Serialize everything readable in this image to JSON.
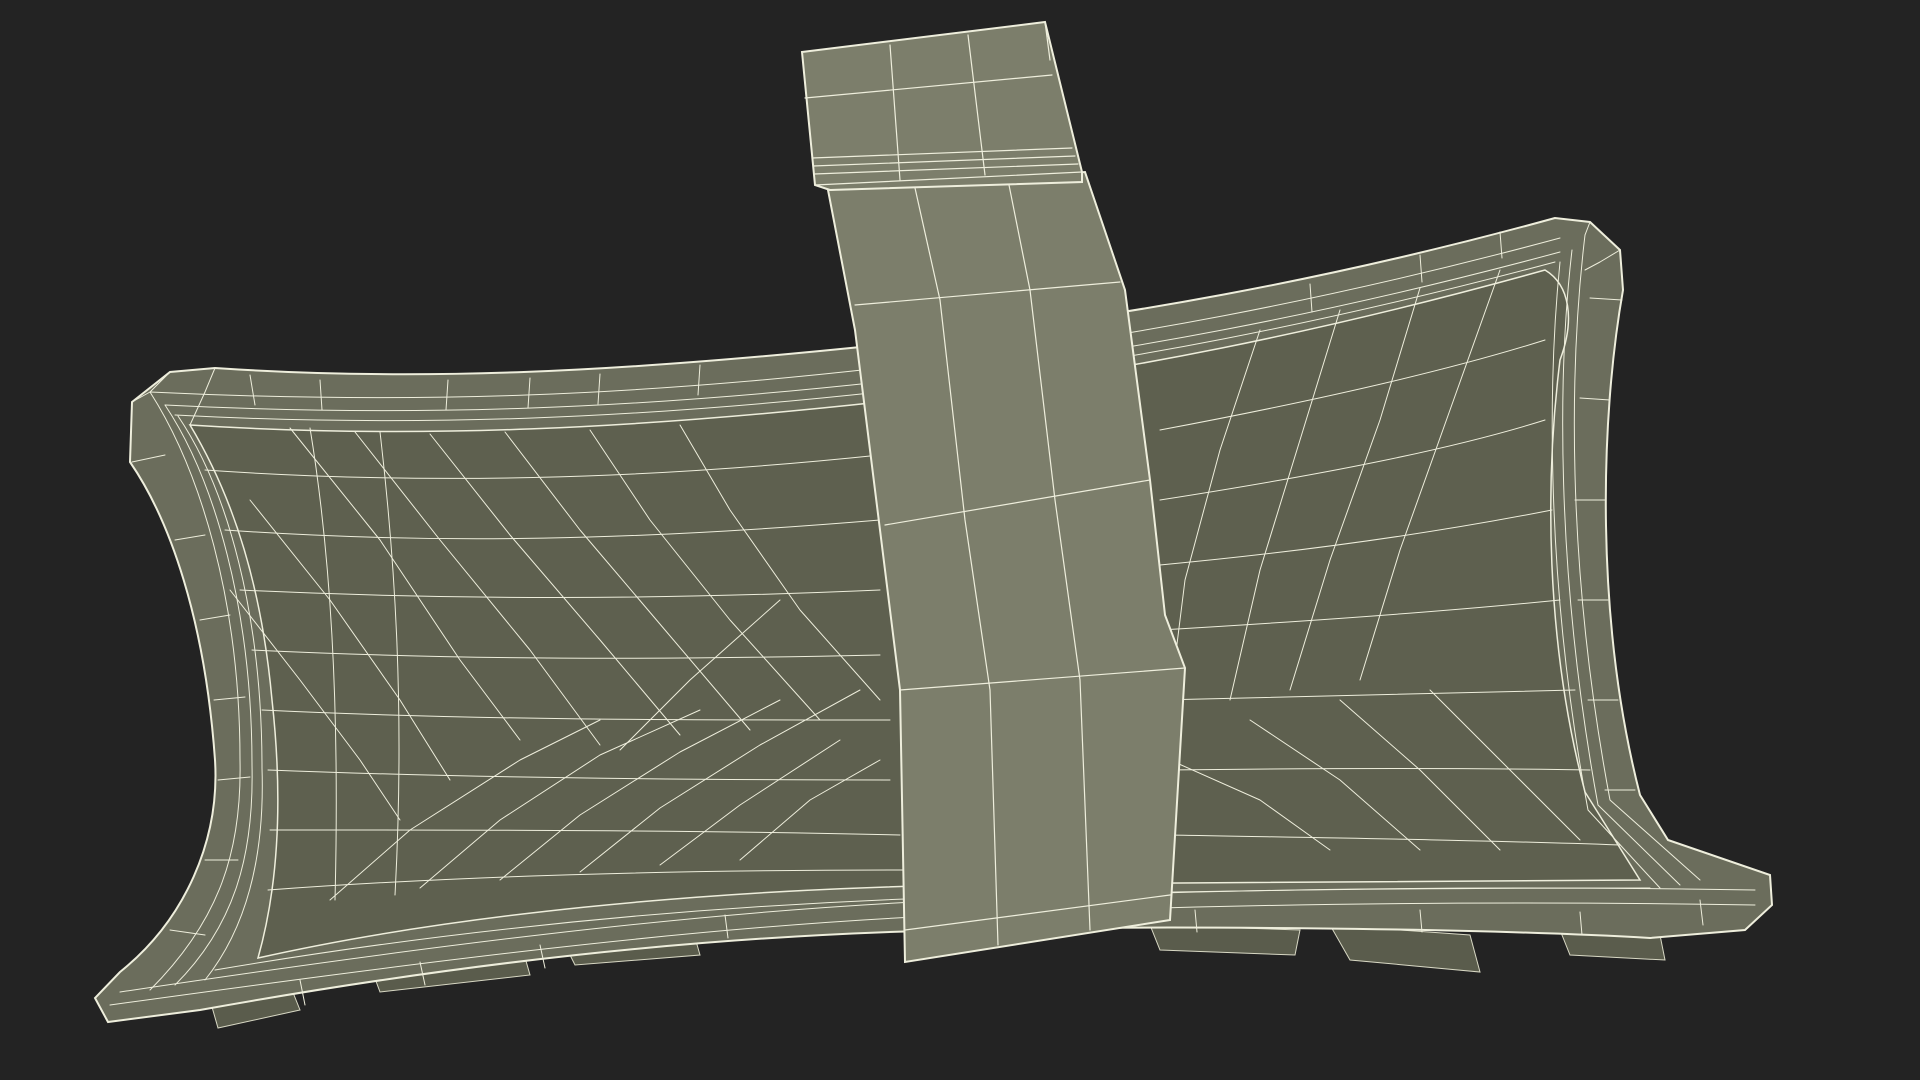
{
  "scene": {
    "background_color": "#232323",
    "model_fill_color": "#6b6d5c",
    "model_inner_color": "#5e604f",
    "model_highlight_color": "#7c7e6b",
    "wireframe_color": "#eeeedc",
    "render_mode": "wireframe-over-shaded"
  },
  "objects": [
    {
      "name": "curved-tray"
    },
    {
      "name": "strap-band"
    },
    {
      "name": "buckle-clip"
    }
  ]
}
